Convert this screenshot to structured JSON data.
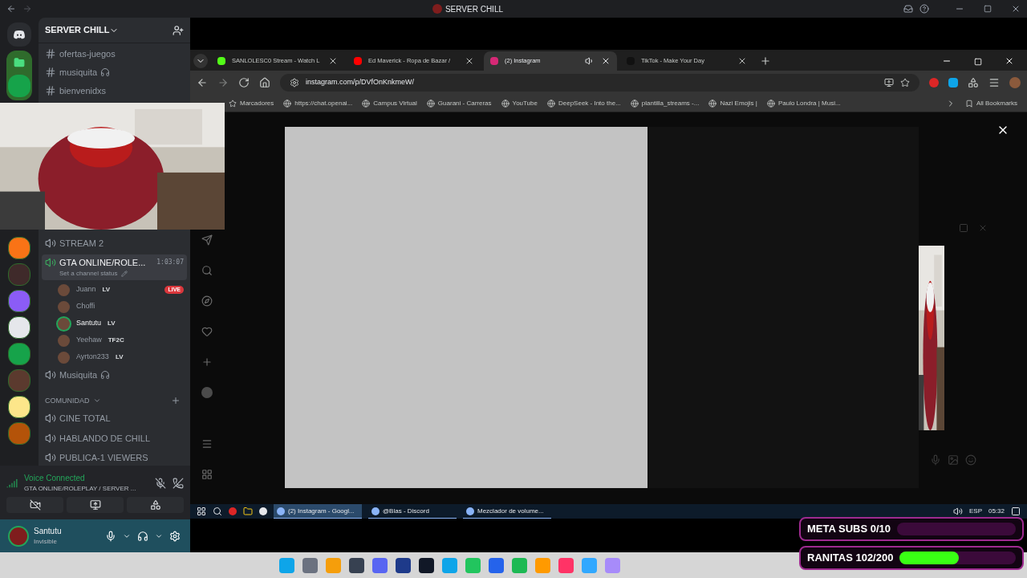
{
  "discord": {
    "title": "SERVER CHILL",
    "server_name": "SERVER CHILL",
    "text_channels": [
      {
        "name": "ofertas-juegos",
        "headphones": false
      },
      {
        "name": "musiquita",
        "headphones": true
      },
      {
        "name": "bienvenidxs",
        "headphones": false
      }
    ],
    "voice_channels": [
      {
        "name": "STREAM 2",
        "selected": false
      },
      {
        "name": "GTA ONLINE/ROLE...",
        "selected": true,
        "time": "1:03:07",
        "status": "Set a channel status",
        "members": [
          {
            "name": "Juann",
            "tag": "LV",
            "live": true,
            "speaking": false
          },
          {
            "name": "Choffi",
            "live": false,
            "speaking": false
          },
          {
            "name": "Santutu",
            "tag": "LV",
            "live": false,
            "speaking": true
          },
          {
            "name": "Yeehaw",
            "tag": "TF2C",
            "live": false,
            "speaking": false
          },
          {
            "name": "Ayrton233",
            "tag": "LV",
            "live": false,
            "speaking": false
          }
        ],
        "live_label": "LIVE"
      },
      {
        "name": "Musiquita",
        "selected": false,
        "headphones": true
      }
    ],
    "category": {
      "name": "COMUNIDAD",
      "channels": [
        {
          "name": "CINE TOTAL"
        },
        {
          "name": "HABLANDO DE CHILL"
        },
        {
          "name": "PUBLICA-1 VIEWERS"
        }
      ]
    },
    "voice_panel": {
      "title": "Voice Connected",
      "channel": "GTA ONLINE/ROLEPLAY / SERVER ..."
    },
    "user": {
      "name": "Santutu",
      "status": "Invisible"
    }
  },
  "browser": {
    "tabs": [
      {
        "title": "SANLOLESC0 Stream - Watch L",
        "selected": false
      },
      {
        "title": "Ed Maverick - Ropa de Bazar / ",
        "selected": false
      },
      {
        "title": "(2) Instagram",
        "selected": true
      },
      {
        "title": "TikTok - Make Your Day",
        "selected": false
      }
    ],
    "url": "instagram.com/p/DVfOnKnkmeW/",
    "bookmarks": [
      "Marcadores",
      "https://chat.openai...",
      "Campus Virtual",
      "Guarani - Carreras",
      "YouTube",
      "DeepSeek - Into the...",
      "plantilla_streams -...",
      "Nazi Emojis |",
      "Paulo Londra | Musi..."
    ],
    "all_bookmarks": "All Bookmarks"
  },
  "taskbar": {
    "items": [
      {
        "label": "(2) Instagram - Googl...",
        "selected": true
      },
      {
        "label": "@Blas - Discord",
        "selected": false
      },
      {
        "label": "Mezclador de volume...",
        "selected": false
      }
    ],
    "language": "ESP",
    "time": "05:32"
  },
  "goals": [
    {
      "label": "META SUBS 0/10",
      "level": 0
    },
    {
      "label": "RANITAS 102/200",
      "level": 0.51
    }
  ]
}
